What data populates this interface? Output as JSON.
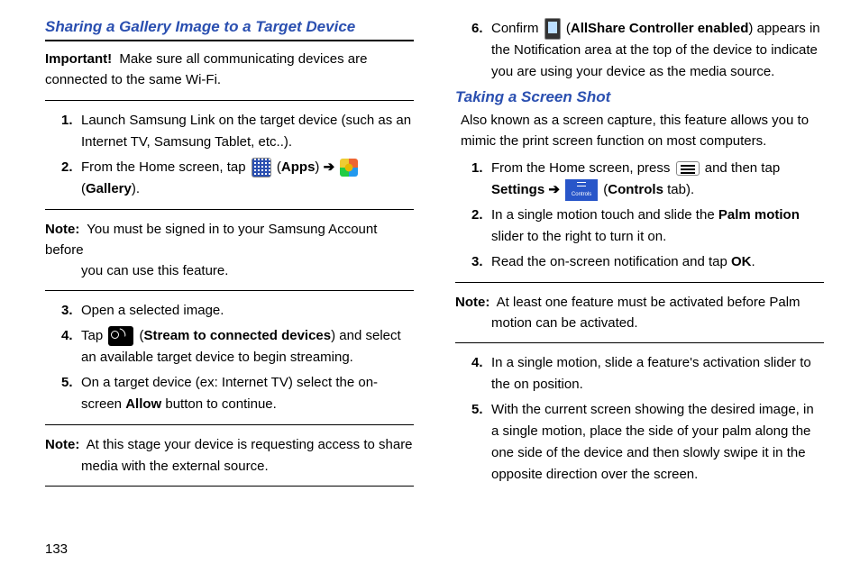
{
  "page_number": "133",
  "left": {
    "heading": "Sharing a Gallery Image to a Target Device",
    "important_label": "Important!",
    "important_text": "Make sure all communicating devices are connected to the same Wi-Fi.",
    "steps_a": [
      {
        "n": "1.",
        "text": "Launch Samsung Link on the target device (such as an Internet TV, Samsung Tablet, etc..)."
      },
      {
        "n": "2.",
        "pre": "From the Home screen, tap ",
        "label1": "Apps",
        "arrow": " ➔ ",
        "label2": "Gallery",
        "post": "."
      }
    ],
    "note1_label": "Note:",
    "note1_first": "You must be signed in to your Samsung Account before",
    "note1_rest": "you can use this feature.",
    "steps_b": [
      {
        "n": "3.",
        "text": "Open a selected image."
      },
      {
        "n": "4.",
        "pre": "Tap ",
        "bold": "Stream to connected devices",
        "post": " and select an available target device to begin streaming."
      },
      {
        "n": "5.",
        "pre": "On a target device (ex: Internet TV) select the on-screen ",
        "bold": "Allow",
        "post": " button to continue."
      }
    ],
    "note2_label": "Note:",
    "note2_first": "At this stage your device is requesting access to share",
    "note2_rest": "media with the external source."
  },
  "right": {
    "step6": {
      "n": "6.",
      "pre": " Confirm ",
      "bold": "AllShare Controller enabled",
      "post": " appears in the Notification area at the top of the device to indicate you are using your device as the media source."
    },
    "heading": "Taking a Screen Shot",
    "intro": "Also known as a screen capture, this feature allows you to mimic the print screen function on most computers.",
    "steps_a": [
      {
        "n": "1.",
        "pre": "From the Home screen, press ",
        "mid": " and then tap ",
        "bold1": "Settings",
        "arrow": " ➔ ",
        "controls_label": "Controls",
        "bold2": "Controls",
        "post": " tab)."
      },
      {
        "n": "2.",
        "pre": "In a single motion touch and slide the ",
        "bold": "Palm motion",
        "post": " slider to the right to turn it on."
      },
      {
        "n": "3.",
        "pre": "Read the on-screen notification and tap ",
        "bold": "OK",
        "post": "."
      }
    ],
    "note_label": "Note:",
    "note_first": "At least one feature must be activated before Palm",
    "note_rest": "motion can be activated.",
    "steps_b": [
      {
        "n": "4.",
        "text": "In a single motion, slide a feature's activation slider to the on position."
      },
      {
        "n": "5.",
        "text": "With the current screen showing the desired image, in a single motion, place the side of your palm along the one side of the device and then slowly swipe it in the opposite direction over the screen."
      }
    ]
  }
}
